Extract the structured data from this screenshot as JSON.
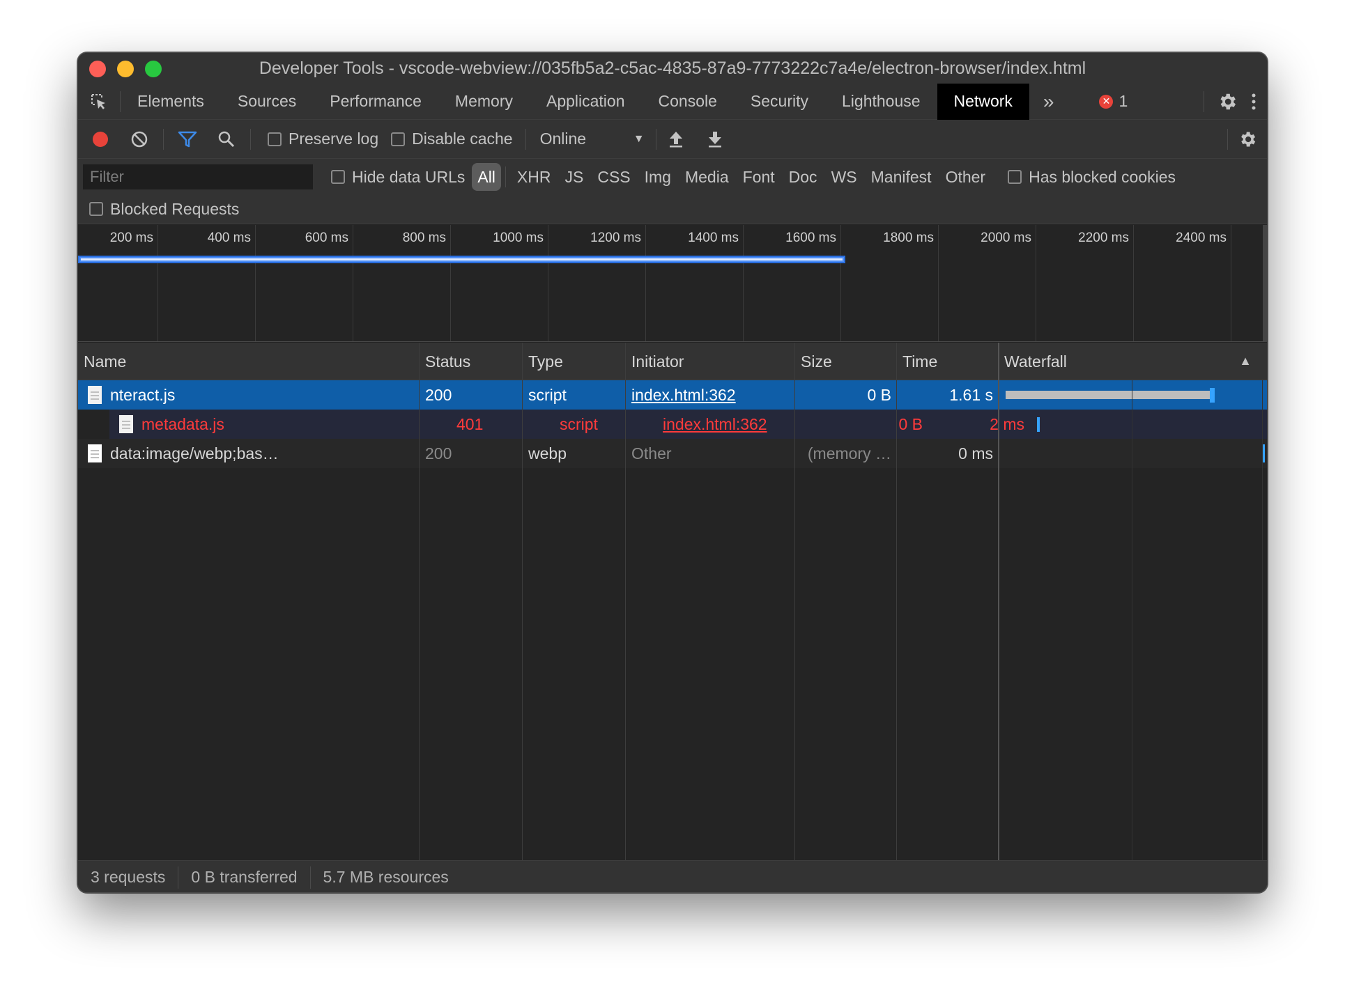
{
  "window": {
    "title": "Developer Tools - vscode-webview://035fb5a2-c5ac-4835-87a9-7773222c7a4e/electron-browser/index.html"
  },
  "tabs": [
    {
      "label": "Elements"
    },
    {
      "label": "Sources"
    },
    {
      "label": "Performance"
    },
    {
      "label": "Memory"
    },
    {
      "label": "Application"
    },
    {
      "label": "Console"
    },
    {
      "label": "Security"
    },
    {
      "label": "Lighthouse"
    },
    {
      "label": "Network",
      "active": true
    }
  ],
  "more_tabs": "»",
  "error_count": "1",
  "toolbar": {
    "preserve_log": "Preserve log",
    "disable_cache": "Disable cache",
    "throttling": "Online"
  },
  "filter": {
    "placeholder": "Filter",
    "hide_data_urls": "Hide data URLs",
    "types": [
      "All",
      "XHR",
      "JS",
      "CSS",
      "Img",
      "Media",
      "Font",
      "Doc",
      "WS",
      "Manifest",
      "Other"
    ],
    "has_blocked_cookies": "Has blocked cookies",
    "blocked_requests": "Blocked Requests"
  },
  "overview": {
    "ticks": [
      "200 ms",
      "400 ms",
      "600 ms",
      "800 ms",
      "1000 ms",
      "1200 ms",
      "1400 ms",
      "1600 ms",
      "1800 ms",
      "2000 ms",
      "2200 ms",
      "2400 ms"
    ],
    "bar_end_ms": 1610
  },
  "columns": {
    "name": "Name",
    "status": "Status",
    "type": "Type",
    "initiator": "Initiator",
    "size": "Size",
    "time": "Time",
    "waterfall": "Waterfall"
  },
  "requests": [
    {
      "name": "nteract.js",
      "status": "200",
      "type": "script",
      "initiator": "index.html:362",
      "size": "0 B",
      "time": "1.61 s"
    },
    {
      "name": "metadata.js",
      "status": "401",
      "type": "script",
      "initiator": "index.html:362",
      "size": "0 B",
      "time": "2 ms"
    },
    {
      "name": "data:image/webp;bas…",
      "status": "200",
      "type": "webp",
      "initiator": "Other",
      "size": "(memory …",
      "time": "0 ms"
    }
  ],
  "status_bar": {
    "requests": "3 requests",
    "transferred": "0 B transferred",
    "resources": "5.7 MB resources"
  },
  "colors": {
    "accent": "#0f5ea8",
    "error": "#ff3b3b",
    "record": "#e8433a",
    "filter_active": "#3d8ae8"
  }
}
